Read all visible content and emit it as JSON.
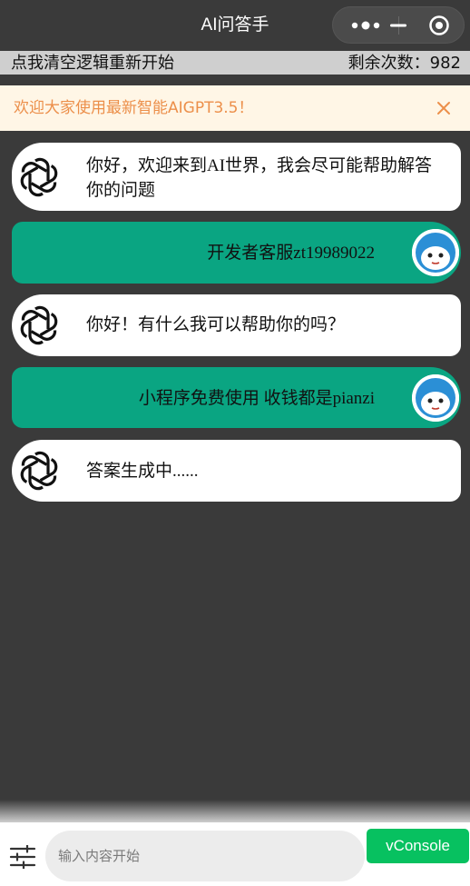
{
  "navbar": {
    "title": "AI问答手"
  },
  "topbar": {
    "clear_label": "点我清空逻辑重新开始",
    "remaining_label": "剩余次数：982"
  },
  "notice": {
    "text": "欢迎大家使用最新智能AIGPT3.5！"
  },
  "messages": [
    {
      "role": "ai",
      "text": "你好，欢迎来到AI世界，我会尽可能帮助解答你的问题"
    },
    {
      "role": "user",
      "text": "开发者客服zt19989022"
    },
    {
      "role": "ai",
      "text": "你好！有什么我可以帮助你的吗？"
    },
    {
      "role": "user",
      "text": "小程序免费使用 收钱都是pianzi"
    },
    {
      "role": "ai",
      "text": "答案生成中......"
    }
  ],
  "input": {
    "placeholder": "输入内容开始"
  },
  "vconsole": {
    "label": "vConsole"
  },
  "colors": {
    "accent": "#0aa582",
    "notice_text": "#ec8f4a",
    "vconsole": "#07c160",
    "background": "#3a3a3a"
  },
  "icons": {
    "ai_avatar": "openai-logo-icon",
    "user_avatar": "cartoon-face-icon",
    "settings": "sliders-icon"
  }
}
